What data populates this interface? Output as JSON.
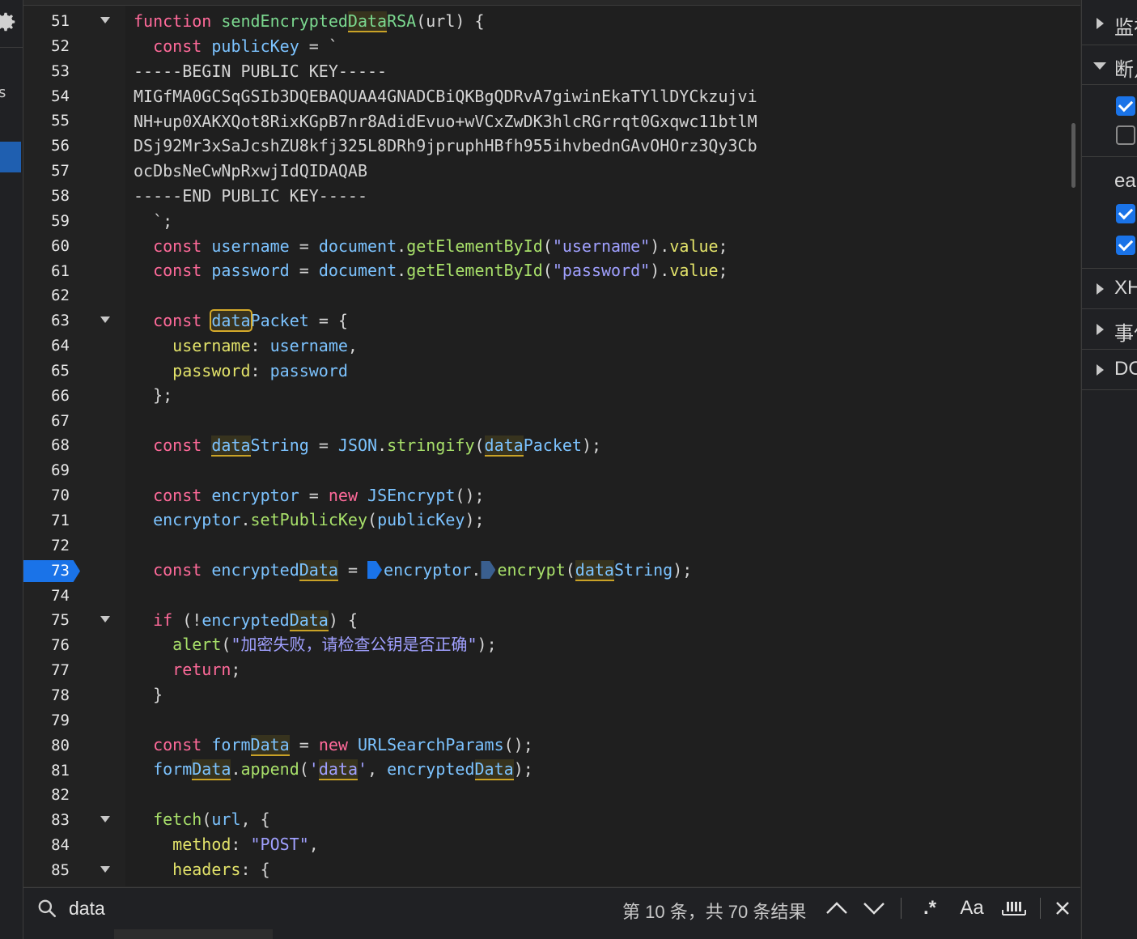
{
  "left_strip": {
    "partial_letter": "s"
  },
  "editor": {
    "current_line": 73,
    "lines": [
      {
        "n": "51",
        "fold": true
      },
      {
        "n": "52",
        "fold": false
      },
      {
        "n": "53",
        "fold": false
      },
      {
        "n": "54",
        "fold": false
      },
      {
        "n": "55",
        "fold": false
      },
      {
        "n": "56",
        "fold": false
      },
      {
        "n": "57",
        "fold": false
      },
      {
        "n": "58",
        "fold": false
      },
      {
        "n": "59",
        "fold": false
      },
      {
        "n": "60",
        "fold": false
      },
      {
        "n": "61",
        "fold": false
      },
      {
        "n": "62",
        "fold": false
      },
      {
        "n": "63",
        "fold": true
      },
      {
        "n": "64",
        "fold": false
      },
      {
        "n": "65",
        "fold": false
      },
      {
        "n": "66",
        "fold": false
      },
      {
        "n": "67",
        "fold": false
      },
      {
        "n": "68",
        "fold": false
      },
      {
        "n": "69",
        "fold": false
      },
      {
        "n": "70",
        "fold": false
      },
      {
        "n": "71",
        "fold": false
      },
      {
        "n": "72",
        "fold": false
      },
      {
        "n": "73",
        "fold": false,
        "breakpoint": true
      },
      {
        "n": "74",
        "fold": false
      },
      {
        "n": "75",
        "fold": true
      },
      {
        "n": "76",
        "fold": false
      },
      {
        "n": "77",
        "fold": false
      },
      {
        "n": "78",
        "fold": false
      },
      {
        "n": "79",
        "fold": false
      },
      {
        "n": "80",
        "fold": false
      },
      {
        "n": "81",
        "fold": false
      },
      {
        "n": "82",
        "fold": false
      },
      {
        "n": "83",
        "fold": true
      },
      {
        "n": "84",
        "fold": false
      },
      {
        "n": "85",
        "fold": true
      }
    ],
    "code": {
      "l51": {
        "kw": "function",
        "name_a": "sendEncrypted",
        "name_hl": "Data",
        "name_b": "RSA",
        "rest": "(url) {"
      },
      "l52": {
        "kw": "const",
        "var": "publicKey",
        "rest": " = `"
      },
      "l53": "-----BEGIN PUBLIC KEY-----",
      "l54": "MIGfMA0GCSqGSIb3DQEBAQUAA4GNADCBiQKBgQDRvA7giwinEkaTYllDYCkzujvi",
      "l55": "NH+up0XAKXQot8RixKGpB7nr8AdidEvuo+wVCxZwDK3hlcRGrrqt0Gxqwc11btlM",
      "l56": "DSj92Mr3xSaJcshZU8kfj325L8DRh9jpruphHBfh955ihvbednGAvOHOrz3Qy3Cb",
      "l57": "ocDbsNeCwNpRxwjIdQIDAQAB",
      "l58": "-----END PUBLIC KEY-----",
      "l59": "`;",
      "l60": {
        "kw": "const",
        "var": "username",
        "eq": " = ",
        "obj": "document",
        "dot": ".",
        "fn": "getElementById",
        "str": "\"username\"",
        "prop": "value",
        "end": ";"
      },
      "l61": {
        "kw": "const",
        "var": "password",
        "eq": " = ",
        "obj": "document",
        "dot": ".",
        "fn": "getElementById",
        "str": "\"password\"",
        "prop": "value",
        "end": ";"
      },
      "l63": {
        "kw": "const",
        "hl": "data",
        "var_b": "Packet",
        "rest": " = {"
      },
      "l64": {
        "prop": "username",
        "colon": ": ",
        "var": "username",
        "end": ","
      },
      "l65": {
        "prop": "password",
        "colon": ": ",
        "var": "password"
      },
      "l66": "};",
      "l68": {
        "kw": "const",
        "hl": "data",
        "var_b": "String",
        "eq": " = ",
        "obj": "JSON",
        "dot": ".",
        "fn": "stringify",
        "arg_hl": "data",
        "arg_b": "Packet",
        "end": ");"
      },
      "l70": {
        "kw": "const",
        "var": "encryptor",
        "eq": " = ",
        "kw2": "new",
        "cls": "JSEncrypt",
        "end": "();"
      },
      "l71": {
        "obj": "encryptor",
        "dot": ".",
        "fn": "setPublicKey",
        "arg": "publicKey",
        "end": ");"
      },
      "l73": {
        "kw": "const",
        "var_a": "encrypted",
        "hl": "Data",
        "eq": " = ",
        "obj": "encryptor",
        "dot": ".",
        "fn": "encrypt",
        "arg_hl": "data",
        "arg_b": "String",
        "end": ");"
      },
      "l75": {
        "kw": "if",
        "open": " (!",
        "var_a": "encrypted",
        "hl": "Data",
        "rest": ") {"
      },
      "l76": {
        "fn": "alert",
        "str": "\"加密失败，请检查公钥是否正确\"",
        "end": ");"
      },
      "l77": {
        "kw": "return",
        "end": ";"
      },
      "l78": "}",
      "l80": {
        "kw": "const",
        "var_a": "form",
        "hl": "Data",
        "eq": " = ",
        "kw2": "new",
        "cls": "URLSearchParams",
        "end": "();"
      },
      "l81": {
        "var_a": "form",
        "hl": "Data",
        "dot": ".",
        "fn": "append",
        "q1": "'",
        "str_hl": "data",
        "q2": "'",
        "comma": ", ",
        "arg_a": "encrypted",
        "arg_hl": "Data",
        "end": ");"
      },
      "l83": {
        "fn": "fetch",
        "open": "(",
        "arg": "url",
        "rest": ", {"
      },
      "l84": {
        "prop": "method",
        "colon": ": ",
        "str": "\"POST\"",
        "end": ","
      },
      "l85": {
        "prop": "headers",
        "colon": ": ",
        "end": "{"
      }
    }
  },
  "right_panel": {
    "sections": [
      {
        "label": "监视",
        "expanded": false
      },
      {
        "label": "断点",
        "expanded": true,
        "checkboxes": [
          true,
          false
        ]
      },
      {
        "label": "ea",
        "checkboxes": [
          true,
          true
        ]
      },
      {
        "label": "XHR",
        "expanded": false
      },
      {
        "label": "事件",
        "expanded": false
      },
      {
        "label": "DOM",
        "expanded": false
      }
    ]
  },
  "search": {
    "query": "data",
    "match_status": "第 10 条，共 70 条结果",
    "regex_label": ".*",
    "case_label": "Aa"
  }
}
